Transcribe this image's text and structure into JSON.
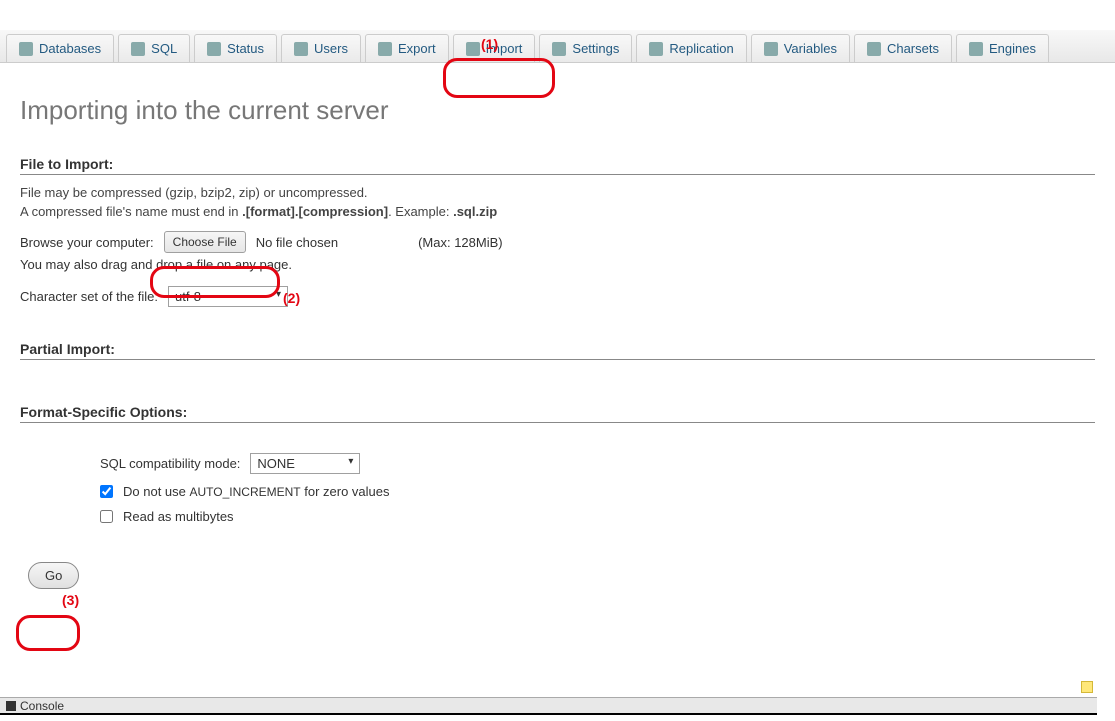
{
  "tabs": [
    {
      "label": "Databases"
    },
    {
      "label": "SQL"
    },
    {
      "label": "Status"
    },
    {
      "label": "Users"
    },
    {
      "label": "Export"
    },
    {
      "label": "Import"
    },
    {
      "label": "Settings"
    },
    {
      "label": "Replication"
    },
    {
      "label": "Variables"
    },
    {
      "label": "Charsets"
    },
    {
      "label": "Engines"
    }
  ],
  "page_title": "Importing into the current server",
  "file_section": {
    "heading": "File to Import:",
    "hint1": "File may be compressed (gzip, bzip2, zip) or uncompressed.",
    "hint2_a": "A compressed file's name must end in ",
    "hint2_b": ".[format].[compression]",
    "hint2_c": ". Example: ",
    "hint2_d": ".sql.zip",
    "browse_label": "Browse your computer:",
    "choose_btn": "Choose File",
    "no_file": "No file chosen",
    "max": "(Max: 128MiB)",
    "drag": "You may also drag and drop a file on any page.",
    "charset_label": "Character set of the file:",
    "charset_value": "utf-8"
  },
  "partial_heading": "Partial Import:",
  "fso": {
    "heading": "Format-Specific Options:",
    "compat_label": "SQL compatibility mode:",
    "compat_value": "NONE",
    "ai_a": "Do not use ",
    "ai_b": "AUTO_INCREMENT",
    "ai_c": " for zero values",
    "mb": "Read as multibytes"
  },
  "go": "Go",
  "console": "Console",
  "ann": {
    "a1": "(1)",
    "a2": "(2)",
    "a3": "(3)"
  }
}
